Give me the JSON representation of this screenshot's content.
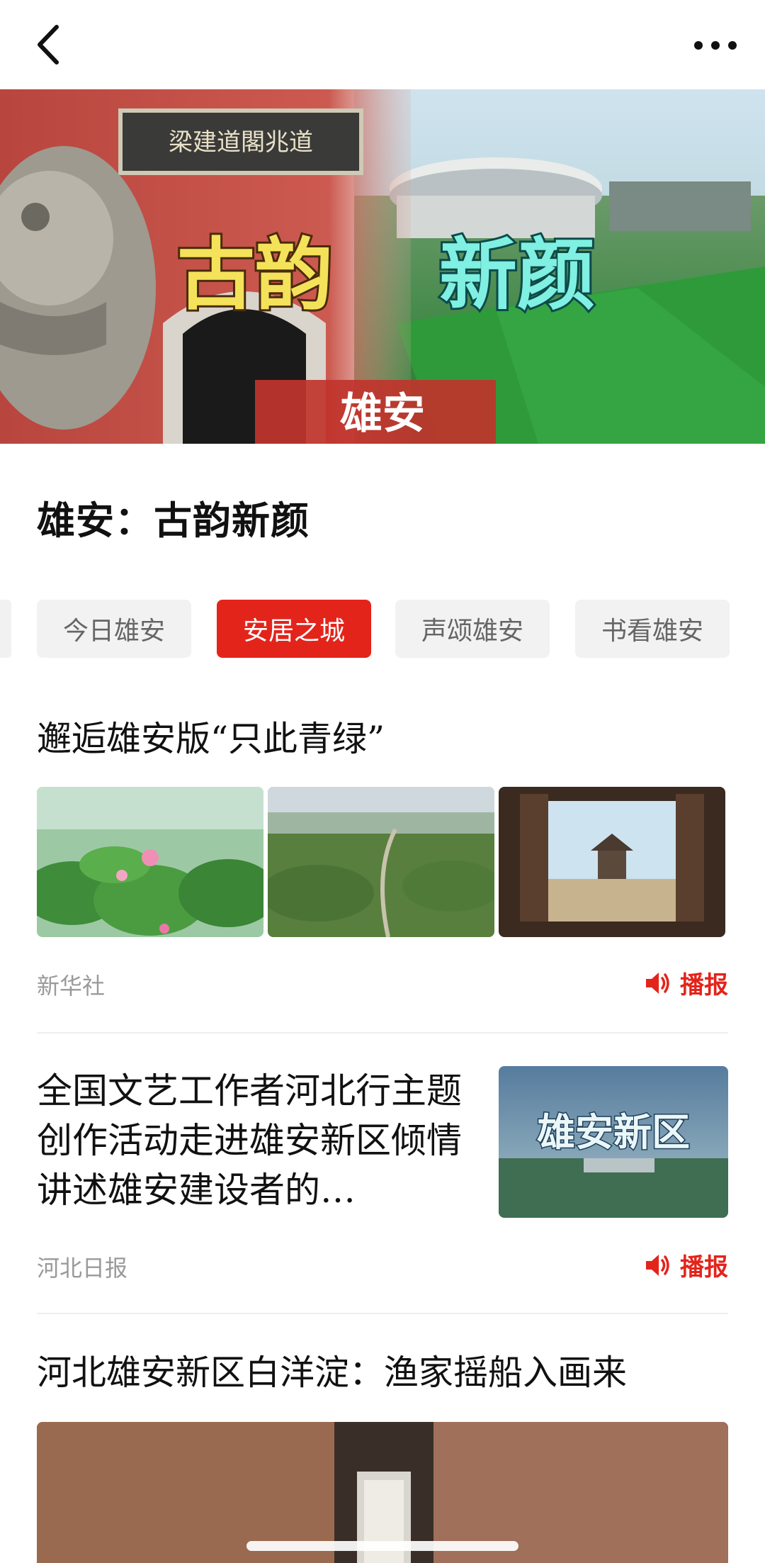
{
  "header": {
    "back_icon": "chevron-left-icon",
    "more_icon": "more-horizontal-icon"
  },
  "hero": {
    "plaque_text": "梁建道閣兆道",
    "headline_left": "古韵",
    "headline_right": "新颜",
    "banner_text": "雄安"
  },
  "page": {
    "title": "雄安：古韵新颜"
  },
  "tabs": [
    {
      "label": "今日雄安",
      "active": false
    },
    {
      "label": "安居之城",
      "active": true
    },
    {
      "label": "声颂雄安",
      "active": false
    },
    {
      "label": "书看雄安",
      "active": false
    }
  ],
  "articles": [
    {
      "title": "邂逅雄安版“只此青绿”",
      "source": "新华社",
      "action_label": "播报",
      "action_icon": "speaker-icon"
    },
    {
      "title": "全国文艺工作者河北行主题创作活动走进雄安新区倾情讲述雄安建设者的…",
      "thumb_text": "雄安新区",
      "source": "河北日报",
      "action_label": "播报",
      "action_icon": "speaker-icon"
    },
    {
      "title": "河北雄安新区白洋淀：渔家摇船入画来"
    }
  ],
  "colors": {
    "accent": "#e3241b",
    "tab_bg": "#f2f2f2",
    "muted_text": "#9a9a9a"
  }
}
